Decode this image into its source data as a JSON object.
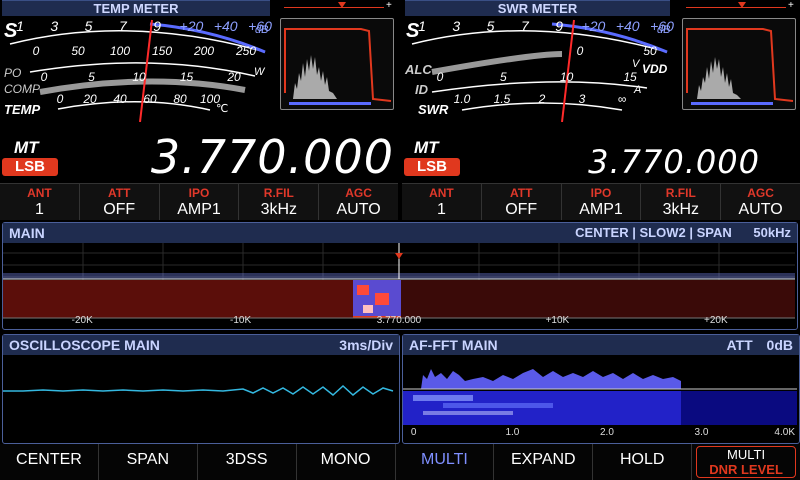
{
  "left_meter": {
    "title": "TEMP METER",
    "s_label": "S",
    "po_label": "PO",
    "comp_label": "COMP",
    "temp_label": "TEMP",
    "s_scale": [
      "1",
      "3",
      "5",
      "7",
      "9",
      "+20",
      "+40",
      "+60"
    ],
    "db_label": "dB",
    "po_scale": [
      "0",
      "50",
      "100",
      "150",
      "200",
      "250"
    ],
    "po_unit": "W",
    "comp_scale": [
      "0",
      "5",
      "10",
      "15",
      "20"
    ],
    "temp_scale": [
      "0",
      "20",
      "40",
      "60",
      "80",
      "100"
    ],
    "temp_unit": "℃"
  },
  "right_meter": {
    "title": "SWR METER",
    "s_label": "S",
    "alc_label": "ALC",
    "id_label": "ID",
    "swr_label": "SWR",
    "vdd_label": "VDD",
    "s_scale": [
      "1",
      "3",
      "5",
      "7",
      "9",
      "+20",
      "+40",
      "+60"
    ],
    "db_label": "dB",
    "vdd_scale": [
      "0",
      "50"
    ],
    "v_unit": "V",
    "id_scale": [
      "0",
      "5",
      "10",
      "15"
    ],
    "a_unit": "A",
    "swr_scale": [
      "1.0",
      "1.5",
      "2",
      "3",
      "∞"
    ]
  },
  "main_vfo": {
    "mt": "MT",
    "mode": "LSB",
    "freq": "3.770.000"
  },
  "sub_vfo": {
    "mt": "MT",
    "mode": "LSB",
    "freq": "3.770.000"
  },
  "status_left": [
    {
      "label": "ANT",
      "value": "1"
    },
    {
      "label": "ATT",
      "value": "OFF"
    },
    {
      "label": "IPO",
      "value": "AMP1"
    },
    {
      "label": "R.FIL",
      "value": "3kHz"
    },
    {
      "label": "AGC",
      "value": "AUTO"
    }
  ],
  "status_right": [
    {
      "label": "ANT",
      "value": "1"
    },
    {
      "label": "ATT",
      "value": "OFF"
    },
    {
      "label": "IPO",
      "value": "AMP1"
    },
    {
      "label": "R.FIL",
      "value": "3kHz"
    },
    {
      "label": "AGC",
      "value": "AUTO"
    }
  ],
  "scope": {
    "title": "MAIN",
    "mode_center": "CENTER",
    "sep": "|",
    "speed": "SLOW2",
    "span_label": "SPAN",
    "span_value": "50kHz",
    "ticks": [
      "-20K",
      "-10K",
      "3.770.000",
      "+10K",
      "+20K"
    ]
  },
  "oscilloscope": {
    "title": "OSCILLOSCOPE MAIN",
    "div": "3ms/Div"
  },
  "affft": {
    "title": "AF-FFT MAIN",
    "att_label": "ATT",
    "att_value": "0dB",
    "ticks": [
      "0",
      "1.0",
      "2.0",
      "3.0",
      "4.0K"
    ]
  },
  "bottom_buttons": [
    "CENTER",
    "SPAN",
    "3DSS",
    "MONO",
    "MULTI",
    "EXPAND",
    "HOLD"
  ],
  "multi_button": {
    "line1": "MULTI",
    "line2": "DNR LEVEL"
  },
  "colors": {
    "accent_red": "#e0381e",
    "header_blue": "#1f2c4f",
    "active_blue": "#7f8fff"
  }
}
